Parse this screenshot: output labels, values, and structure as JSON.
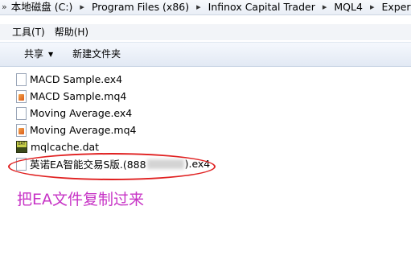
{
  "breadcrumb": [
    "本地磁盘 (C:)",
    "Program Files (x86)",
    "Infinox Capital Trader",
    "MQL4",
    "Experts"
  ],
  "menu": [
    "工具(T)",
    "帮助(H)"
  ],
  "commands": {
    "share": "共享",
    "new_folder": "新建文件夹"
  },
  "files": [
    {
      "name": "MACD Sample.ex4",
      "icon": "blank-file-icon"
    },
    {
      "name": "MACD Sample.mq4",
      "icon": "mq4-file-icon"
    },
    {
      "name": "Moving Average.ex4",
      "icon": "blank-file-icon"
    },
    {
      "name": "Moving Average.mq4",
      "icon": "mq4-file-icon"
    },
    {
      "name": "mqlcache.dat",
      "icon": "dat-file-icon"
    }
  ],
  "highlighted_file": {
    "prefix": "英诺EA智能交易S版.(888",
    "suffix": ").ex4"
  },
  "annotation": "把EA文件复制过来",
  "colors": {
    "annotation": "#c733c6",
    "ellipse": "#e02020"
  }
}
